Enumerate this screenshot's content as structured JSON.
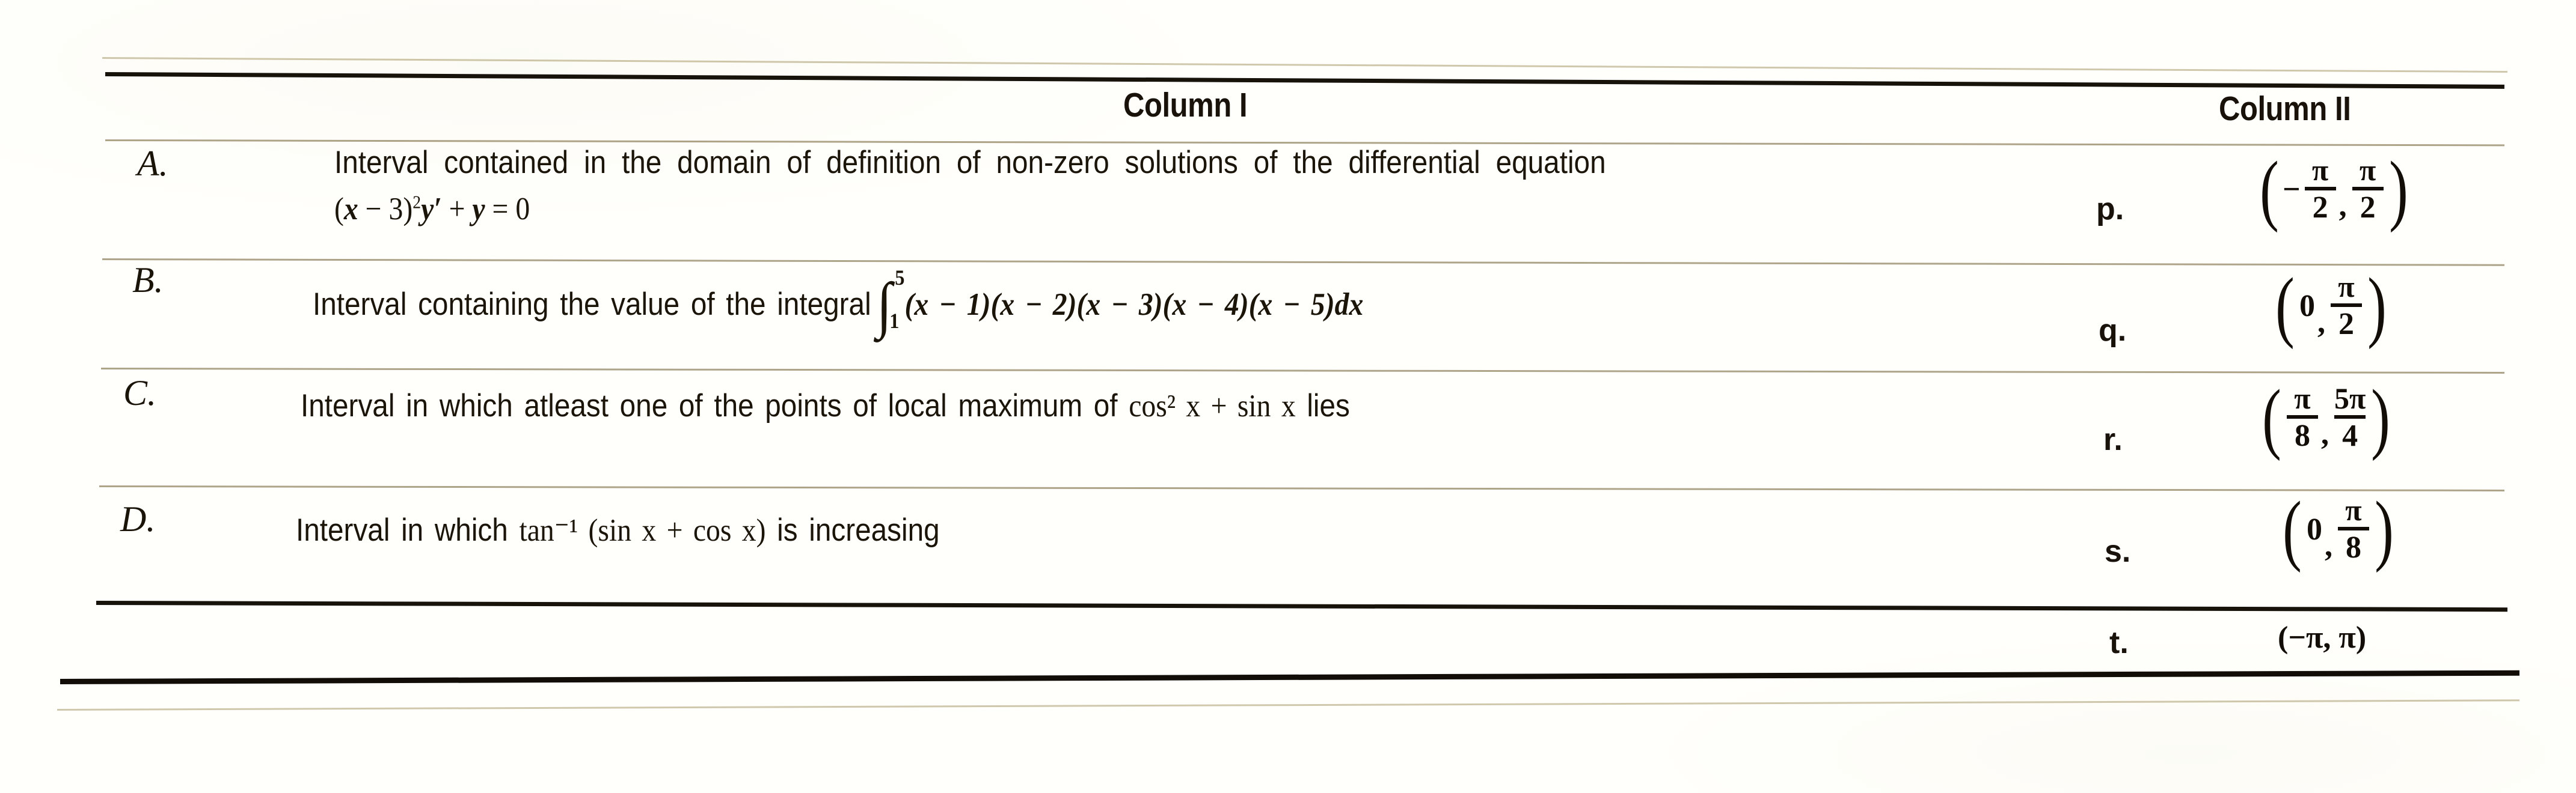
{
  "document": {
    "type": "match-the-columns-table",
    "headers": {
      "column_one": "Column I",
      "column_two": "Column II"
    }
  },
  "column_one": {
    "rows": [
      {
        "key": "A.",
        "line1": "Interval contained in the domain of definition of non-zero solutions of the differential equation",
        "line2_plain": "(x − 3)² y′ + y = 0",
        "expression_parts": {
          "base_open": "(",
          "var": "x",
          "minus": " − ",
          "const": "3",
          "base_close": ")",
          "power": "2",
          "yprime": "y′",
          "plus": " + ",
          "y": "y",
          "equals": " = ",
          "zero": "0"
        }
      },
      {
        "key": "B.",
        "text_before": "Interval containing the value of the integral",
        "integral": {
          "lower": "1",
          "upper": "5"
        },
        "integrand": "(x − 1)(x − 2)(x − 3)(x − 4)(x − 5)dx",
        "integrand_factors": [
          "(x − 1)",
          "(x − 2)",
          "(x − 3)",
          "(x − 4)",
          "(x − 5)"
        ],
        "differential": "dx"
      },
      {
        "key": "C.",
        "text_before": "Interval in which atleast one of the points of local maximum of",
        "function": "cos² x + sin x",
        "text_after": "lies"
      },
      {
        "key": "D.",
        "text_before": "Interval in which",
        "function": "tan⁻¹ (sin x + cos x)",
        "text_after": "is increasing"
      }
    ]
  },
  "column_two": {
    "options": [
      {
        "key": "p.",
        "interval": "(−π/2, π/2)",
        "left": {
          "sign": "−",
          "num": "π",
          "den": "2"
        },
        "right": {
          "num": "π",
          "den": "2"
        }
      },
      {
        "key": "q.",
        "interval": "(0, π/2)",
        "left_plain": "0",
        "right": {
          "num": "π",
          "den": "2"
        }
      },
      {
        "key": "r.",
        "interval": "(π/8, 5π/4)",
        "left": {
          "num": "π",
          "den": "8"
        },
        "right": {
          "num": "5π",
          "den": "4"
        }
      },
      {
        "key": "s.",
        "interval": "(0, π/8)",
        "left_plain": "0",
        "right": {
          "num": "π",
          "den": "8"
        }
      },
      {
        "key": "t.",
        "interval": "(−π, π)",
        "flat": "(−π, π)"
      }
    ]
  },
  "glyphs": {
    "pi": "π",
    "minus": "−",
    "comma": ",",
    "paren_open": "(",
    "paren_close": ")",
    "integral_sign": "∫"
  },
  "colors": {
    "ink": "#18120a",
    "rule": "#14100a",
    "faint_rule": "#8a7636",
    "paper": "#fffffc"
  }
}
